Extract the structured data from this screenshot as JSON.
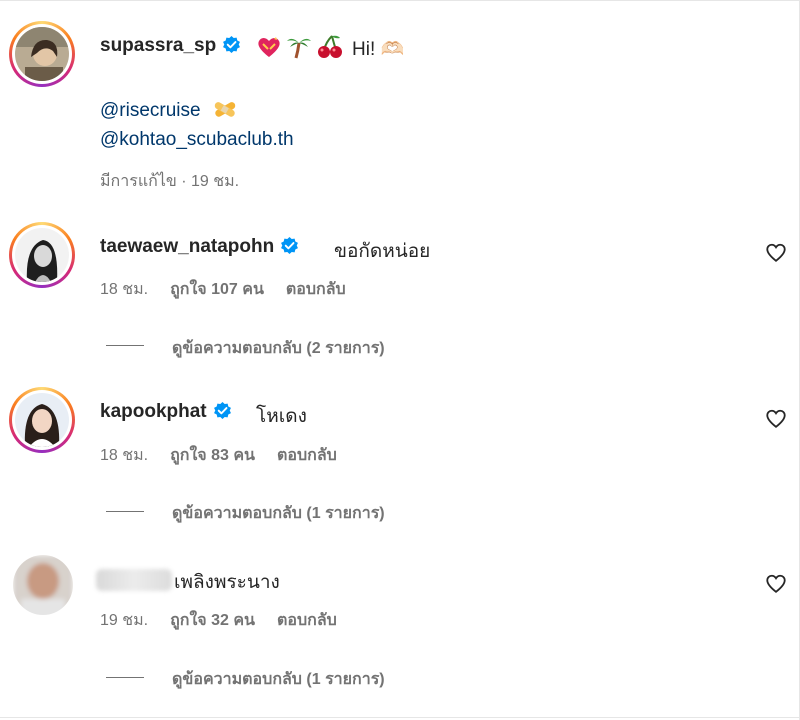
{
  "post": {
    "username": "supassra_sp",
    "text": "Hi! 🫶🏻",
    "emoji_icons": [
      "heart-with-ribbon-icon",
      "palm-tree-icon",
      "cherries-icon"
    ],
    "mentions": [
      "@risecruise",
      "@kohtao_scubaclub.th"
    ],
    "meta": "มีการแก้ไข · 19 ชม."
  },
  "comments": [
    {
      "username": "taewaew_natapohn",
      "verified": true,
      "text": "ขอกัดหน่อย",
      "time": "18 ชม.",
      "likes": "ถูกใจ 107 คน",
      "reply": "ตอบกลับ",
      "view_replies": "ดูข้อความตอบกลับ (2 รายการ)"
    },
    {
      "username": "kapookphat",
      "verified": true,
      "text": "โหเดง",
      "time": "18 ชม.",
      "likes": "ถูกใจ 83 คน",
      "reply": "ตอบกลับ",
      "view_replies": "ดูข้อความตอบกลับ (1 รายการ)"
    },
    {
      "username": "",
      "verified": false,
      "text": "เพลิงพระนาง",
      "time": "19 ชม.",
      "likes": "ถูกใจ 32 คน",
      "reply": "ตอบกลับ",
      "view_replies": "ดูข้อความตอบกลับ (1 รายการ)"
    }
  ],
  "colors": {
    "text": "#262626",
    "secondary": "#737373",
    "mention": "#00376b",
    "verified": "#0095f6"
  }
}
